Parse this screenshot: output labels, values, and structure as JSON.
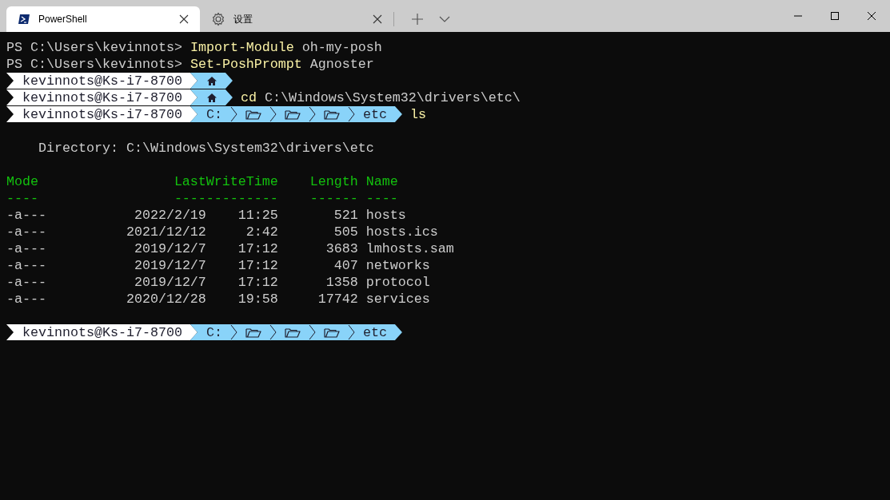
{
  "tabs": [
    {
      "label": "PowerShell",
      "kind": "powershell",
      "selected": true
    },
    {
      "label": "设置",
      "kind": "settings",
      "selected": false
    }
  ],
  "terminal": [
    {
      "kind": "text",
      "spans": [
        {
          "text": "PS C:\\Users\\kevinnots> ",
          "color": "#cccccc"
        },
        {
          "text": "Import-Module",
          "color": "#f9f1a5"
        },
        {
          "text": " oh-my-posh",
          "color": "#cccccc"
        }
      ]
    },
    {
      "kind": "text",
      "spans": [
        {
          "text": "PS C:\\Users\\kevinnots> ",
          "color": "#cccccc"
        },
        {
          "text": "Set-PoshPrompt",
          "color": "#f9f1a5"
        },
        {
          "text": " Agnoster",
          "color": "#cccccc"
        }
      ]
    },
    {
      "kind": "prompt",
      "user": "kevinnots@Ks-i7-8700",
      "path": [
        {
          "kind": "home"
        }
      ]
    },
    {
      "kind": "prompt",
      "user": "kevinnots@Ks-i7-8700",
      "path": [
        {
          "kind": "home"
        }
      ],
      "command": [
        {
          "text": "cd",
          "color": "#f9f1a5"
        },
        {
          "text": " C:\\Windows\\System32\\drivers\\etc\\",
          "color": "#cccccc"
        }
      ]
    },
    {
      "kind": "prompt",
      "user": "kevinnots@Ks-i7-8700",
      "path": [
        {
          "kind": "text",
          "text": "C:"
        },
        {
          "kind": "folder"
        },
        {
          "kind": "folder"
        },
        {
          "kind": "folder"
        },
        {
          "kind": "text",
          "text": "etc"
        }
      ],
      "command": [
        {
          "text": "ls",
          "color": "#f9f1a5"
        }
      ]
    },
    {
      "kind": "info",
      "text": "Directory: C:\\Windows\\System32\\drivers\\etc"
    },
    {
      "kind": "table",
      "columns": [
        {
          "title": "Mode",
          "rule": "----"
        },
        {
          "title": "LastWriteTime",
          "rule": "-------------"
        },
        {
          "title": "Length",
          "rule": "------"
        },
        {
          "title": "Name",
          "rule": "----"
        }
      ],
      "rows": [
        {
          "mode": "-a---",
          "date": "2022/2/19",
          "time": "11:25",
          "length": "521",
          "name": "hosts"
        },
        {
          "mode": "-a---",
          "date": "2021/12/12",
          "time": "2:42",
          "length": "505",
          "name": "hosts.ics"
        },
        {
          "mode": "-a---",
          "date": "2019/12/7",
          "time": "17:12",
          "length": "3683",
          "name": "lmhosts.sam"
        },
        {
          "mode": "-a---",
          "date": "2019/12/7",
          "time": "17:12",
          "length": "407",
          "name": "networks"
        },
        {
          "mode": "-a---",
          "date": "2019/12/7",
          "time": "17:12",
          "length": "1358",
          "name": "protocol"
        },
        {
          "mode": "-a---",
          "date": "2020/12/28",
          "time": "19:58",
          "length": "17742",
          "name": "services"
        }
      ]
    },
    {
      "kind": "prompt",
      "user": "kevinnots@Ks-i7-8700",
      "path": [
        {
          "kind": "text",
          "text": "C:"
        },
        {
          "kind": "folder"
        },
        {
          "kind": "folder"
        },
        {
          "kind": "folder"
        },
        {
          "kind": "text",
          "text": "etc"
        }
      ]
    }
  ]
}
